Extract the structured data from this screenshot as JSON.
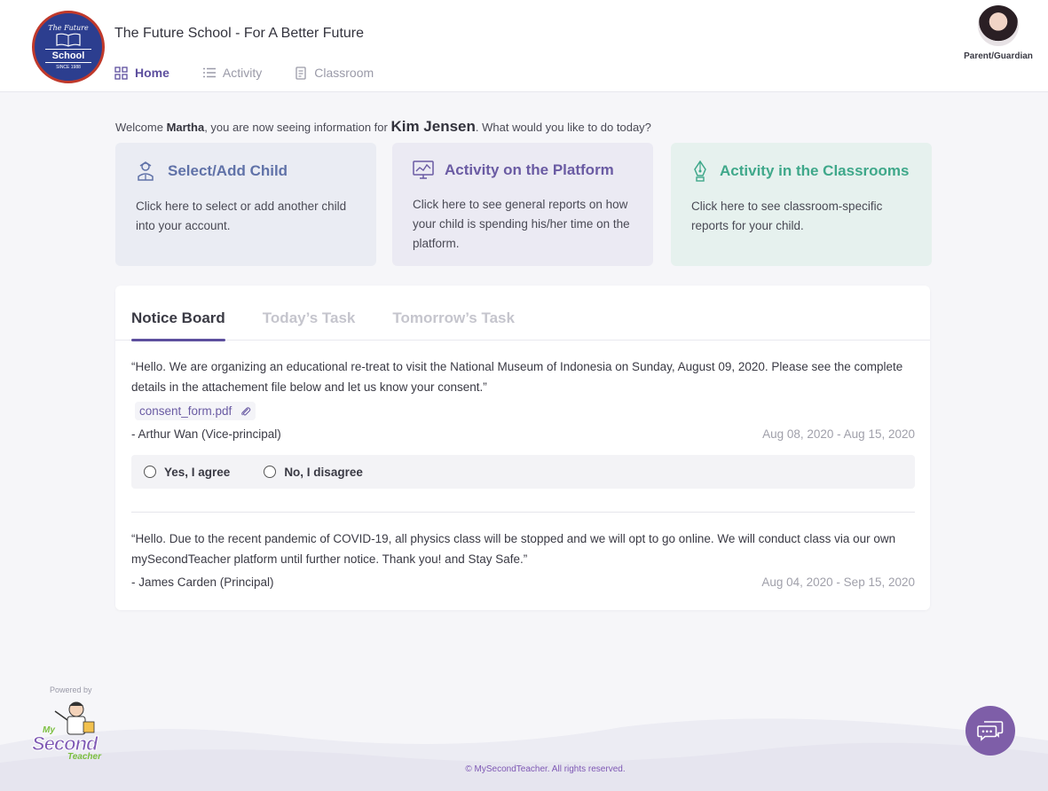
{
  "header": {
    "logo": {
      "top_text": "The Future",
      "name": "School",
      "since": "SINCE 1988"
    },
    "title": "The Future School - For A Better Future",
    "nav": [
      {
        "label": "Home",
        "active": true,
        "icon": "grid-icon"
      },
      {
        "label": "Activity",
        "active": false,
        "icon": "list-icon"
      },
      {
        "label": "Classroom",
        "active": false,
        "icon": "notebook-icon"
      }
    ],
    "profile": {
      "role": "Parent/Guardian"
    }
  },
  "welcome": {
    "prefix": "Welcome ",
    "user": "Martha",
    "middle": ", you are now seeing information for ",
    "child": "Kim Jensen",
    "suffix": ". What would you like to do today?"
  },
  "cards": [
    {
      "title": "Select/Add Child",
      "desc": "Click here to select or add another child into your account.",
      "icon": "child-icon",
      "color": "#6072a8"
    },
    {
      "title": "Activity on the Platform",
      "desc": "Click here to see general reports on how your child is spending his/her time on the platform.",
      "icon": "monitor-chart-icon",
      "color": "#6a5ba3"
    },
    {
      "title": "Activity in the Classrooms",
      "desc": "Click here to see classroom-specific reports for your child.",
      "icon": "pen-nib-icon",
      "color": "#3fa88a"
    }
  ],
  "tabs": [
    {
      "label": "Notice Board",
      "active": true
    },
    {
      "label": "Today’s Task",
      "active": false
    },
    {
      "label": "Tomorrow’s Task",
      "active": false
    }
  ],
  "notices": [
    {
      "message": "“Hello. We are organizing an educational re-treat to visit the National Museum of Indonesia on Sunday, August 09, 2020. Please see the complete details in the attachement file below and let us know your consent.”",
      "attachment": "consent_form.pdf",
      "author": "- Arthur Wan (Vice-principal)",
      "dates": "Aug 08, 2020 - Aug 15, 2020",
      "options": [
        "Yes, I agree",
        "No, I disagree"
      ]
    },
    {
      "message": "“Hello. Due to the recent pandemic of COVID-19, all physics class will be stopped and we will opt to go online. We will conduct class via our own mySecondTeacher platform until further notice. Thank you! and Stay Safe.”",
      "author": "- James Carden (Principal)",
      "dates": "Aug 04, 2020  - Sep 15, 2020"
    }
  ],
  "footer": {
    "powered_by": "Powered by",
    "brand": {
      "line1": "My",
      "line2": "Second",
      "line3": "Teacher"
    },
    "copyright": "© MySecondTeacher. All rights reserved.",
    "chat_icon": "chat-bubbles-icon"
  },
  "colors": {
    "accent": "#5d4f9e",
    "brand_purple": "#7e5ea8",
    "card_blue": "#6072a8",
    "card_green": "#3fa88a"
  }
}
